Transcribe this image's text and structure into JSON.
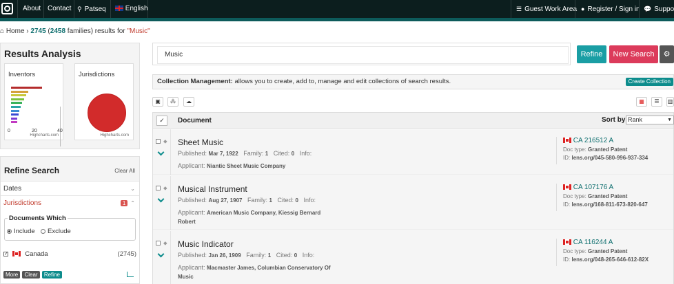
{
  "nav": {
    "about": "About",
    "contact": "Contact",
    "patseq": "Patseq",
    "language": "English",
    "guest": "Guest Work Area",
    "register": "Register / Sign in",
    "support": "Support"
  },
  "breadcrumb": {
    "home": "Home",
    "count": "2745",
    "families_count": "2458",
    "families_text": "families) results for",
    "query": "\"Music\""
  },
  "analysis": {
    "title": "Results Analysis",
    "inventors": "Inventors",
    "jurisdictions": "Jurisdictions",
    "ticks": [
      "0",
      "20",
      "40"
    ],
    "credit": "Highcharts.com",
    "inventor_bars": [
      {
        "value": 0.62,
        "color": "#b42c2c"
      },
      {
        "value": 0.35,
        "color": "#d4a03a"
      },
      {
        "value": 0.3,
        "color": "#c8c83a"
      },
      {
        "value": 0.26,
        "color": "#7cc23a"
      },
      {
        "value": 0.22,
        "color": "#3ab25a"
      },
      {
        "value": 0.19,
        "color": "#2aa5a5"
      },
      {
        "value": 0.17,
        "color": "#3a8ad4"
      },
      {
        "value": 0.15,
        "color": "#3a4ad4"
      },
      {
        "value": 0.13,
        "color": "#7a3ad4"
      },
      {
        "value": 0.12,
        "color": "#c23ac2"
      }
    ]
  },
  "refine": {
    "title": "Refine Search",
    "clear_all": "Clear All",
    "dates": "Dates",
    "jurisdictions": "Jurisdictions",
    "jurisdictions_badge": "1",
    "documents_which": "Documents Which",
    "include": "Include",
    "exclude": "Exclude",
    "country": "Canada",
    "country_count": "(2745)",
    "more": "More",
    "clear": "Clear",
    "refine": "Refine"
  },
  "search": {
    "value": "Music",
    "refine_btn": "Refine",
    "new_search_btn": "New Search"
  },
  "collection": {
    "label": "Collection Management:",
    "text": "allows you to create, add to, manage and edit collections of search results.",
    "create_btn": "Create Collection"
  },
  "list": {
    "document_header": "Document",
    "sort_label": "Sort by",
    "sort_value": "Rank",
    "labels": {
      "published": "Published:",
      "family": "Family:",
      "cited": "Cited:",
      "info": "Info:",
      "applicant": "Applicant:",
      "doc_type": "Doc type:",
      "id": "ID:"
    },
    "records": [
      {
        "title": "Sheet Music",
        "published": "Mar 7, 1922",
        "family": "1",
        "cited": "0",
        "applicant": "Niantic Sheet Music Company",
        "number": "CA 216512 A",
        "doc_type": "Granted Patent",
        "id": "lens.org/045-580-996-937-334"
      },
      {
        "title": "Musical Instrument",
        "published": "Aug 27, 1907",
        "family": "1",
        "cited": "0",
        "applicant": "American Music Company, Kiessig Bernard Robert",
        "number": "CA 107176 A",
        "doc_type": "Granted Patent",
        "id": "lens.org/168-811-673-820-647"
      },
      {
        "title": "Music Indicator",
        "published": "Jan 26, 1909",
        "family": "1",
        "cited": "0",
        "applicant": "Macmaster James, Columbian Conservatory Of Music",
        "number": "CA 116244 A",
        "doc_type": "Granted Patent",
        "id": "lens.org/048-265-646-612-82X"
      }
    ]
  },
  "colors": {
    "accent": "#0d8c8c",
    "danger": "#dc3b5b",
    "topbar": "#0c1e1e"
  }
}
